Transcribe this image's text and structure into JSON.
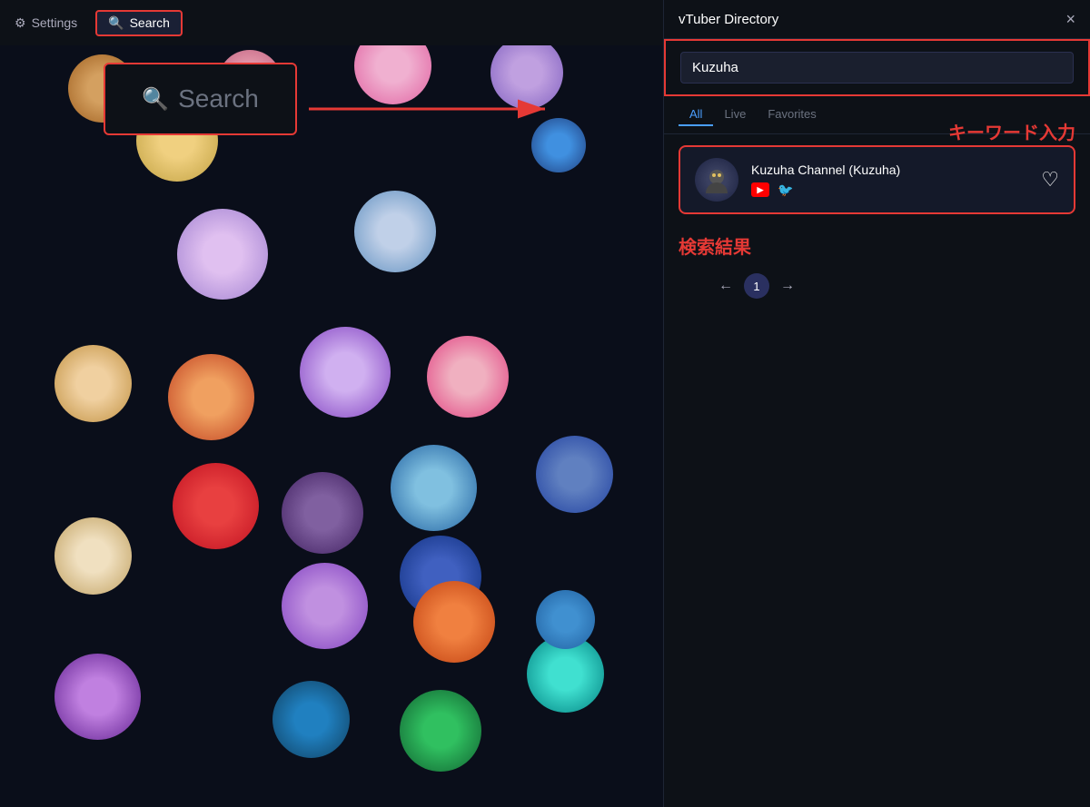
{
  "topbar": {
    "settings_label": "Settings",
    "search_label": "Search"
  },
  "search_overlay": {
    "placeholder": "Search"
  },
  "dialog": {
    "title": "vTuber Directory",
    "close_label": "×",
    "search_value": "Kuzuha",
    "tabs": [
      {
        "label": "All",
        "active": true
      },
      {
        "label": "Live",
        "active": false
      },
      {
        "label": "Favorites",
        "active": false
      }
    ],
    "result": {
      "name": "Kuzuha Channel (Kuzuha)",
      "youtube_label": "▶",
      "twitter_label": "🐦",
      "favorite_icon": "♡"
    },
    "annotation_keyword": "キーワード入力",
    "annotation_results": "検索結果",
    "pagination": {
      "prev": "←",
      "page": "1",
      "next": "→"
    }
  }
}
